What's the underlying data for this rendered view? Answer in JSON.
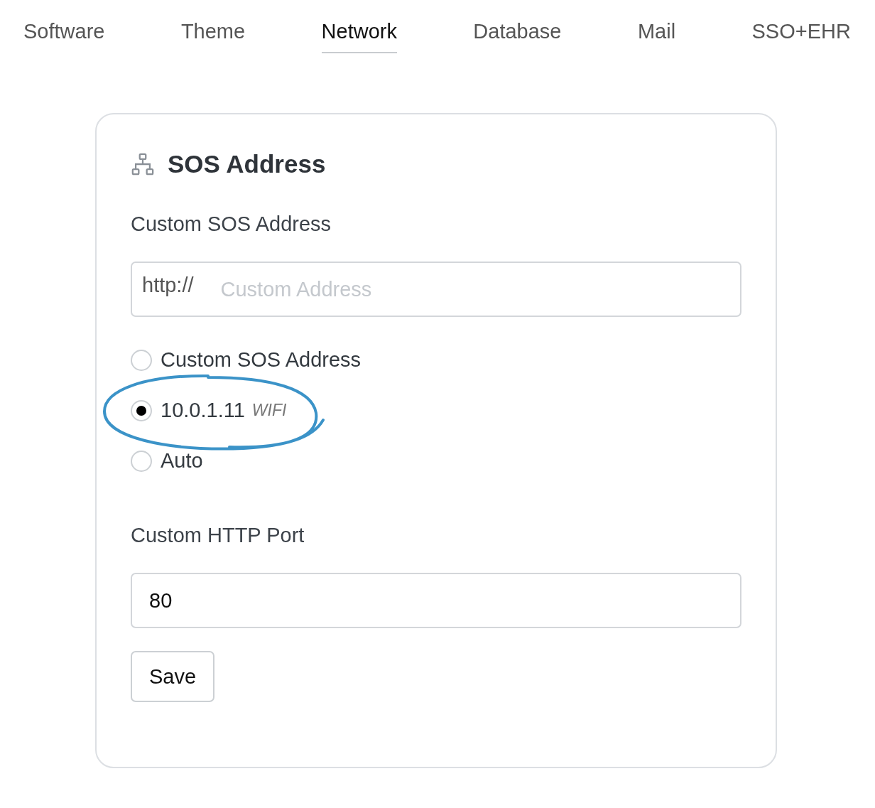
{
  "tabs": [
    {
      "label": "Software",
      "selected": false
    },
    {
      "label": "Theme",
      "selected": false
    },
    {
      "label": "Network",
      "selected": true
    },
    {
      "label": "Database",
      "selected": false
    },
    {
      "label": "Mail",
      "selected": false
    },
    {
      "label": "SSO+EHR",
      "selected": false
    }
  ],
  "card": {
    "title": "SOS Address",
    "address_label": "Custom SOS Address",
    "address_field": {
      "prefix": "http://",
      "placeholder": "Custom Address"
    },
    "options": [
      {
        "label": "Custom SOS Address",
        "selected": false
      },
      {
        "label": "10.0.1.11",
        "tag": "WIFI",
        "selected": true
      },
      {
        "label": "Auto",
        "selected": false
      }
    ],
    "port_label": "Custom HTTP Port",
    "port_field": {
      "value": "80"
    },
    "save_button": "Save"
  }
}
